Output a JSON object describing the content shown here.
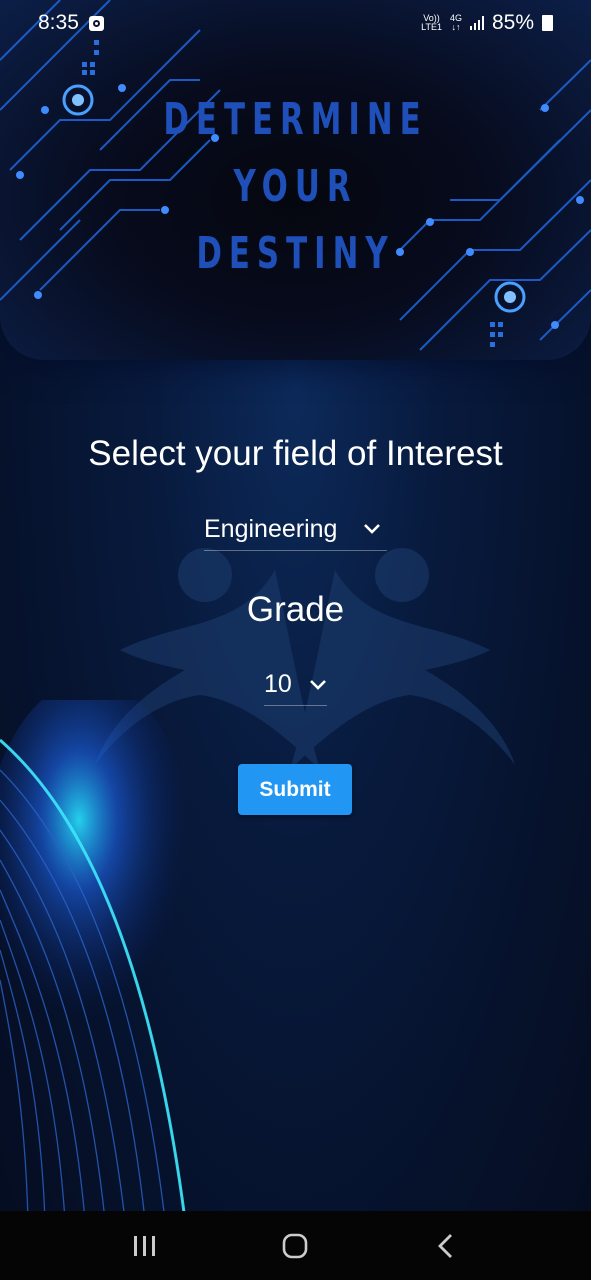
{
  "status_bar": {
    "time": "8:35",
    "volte_label": "Vo))",
    "lte_label": "LTE1",
    "network_type": "4G",
    "battery": "85%"
  },
  "header": {
    "title_lines": [
      "DETERMINE",
      "YOUR",
      "DESTINY"
    ],
    "title_color": "#1f4fb8"
  },
  "form": {
    "field_heading": "Select your field of Interest",
    "field_selected": "Engineering",
    "grade_heading": "Grade",
    "grade_selected": "10",
    "submit_label": "Submit",
    "submit_color": "#2196f3"
  },
  "nav_bar": {
    "recents_icon": "recents-icon",
    "home_icon": "home-icon",
    "back_icon": "back-icon"
  }
}
